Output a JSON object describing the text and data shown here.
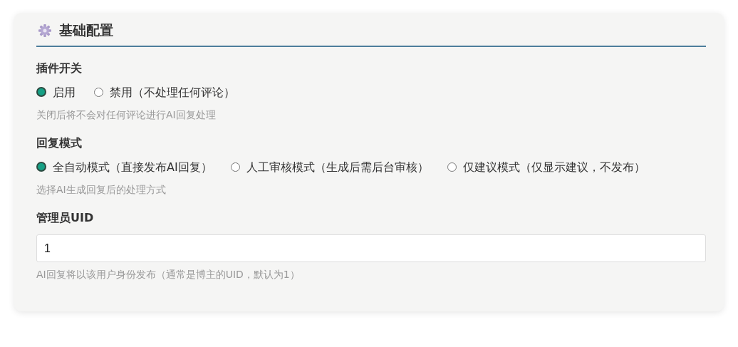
{
  "section": {
    "title": "基础配置"
  },
  "fields": [
    {
      "kind": "radio",
      "label": "插件开关",
      "options": [
        {
          "label": "启用",
          "selected": true
        },
        {
          "label": "禁用（不处理任何评论）",
          "selected": false
        }
      ],
      "hint": "关闭后将不会对任何评论进行AI回复处理"
    },
    {
      "kind": "radio",
      "label": "回复模式",
      "options": [
        {
          "label": "全自动模式（直接发布AI回复）",
          "selected": true
        },
        {
          "label": "人工审核模式（生成后需后台审核）",
          "selected": false
        },
        {
          "label": "仅建议模式（仅显示建议，不发布）",
          "selected": false
        }
      ],
      "hint": "选择AI生成回复后的处理方式"
    },
    {
      "kind": "text",
      "label": "管理员UID",
      "value": "1",
      "hint": "AI回复将以该用户身份发布（通常是博主的UID，默认为1）"
    }
  ]
}
